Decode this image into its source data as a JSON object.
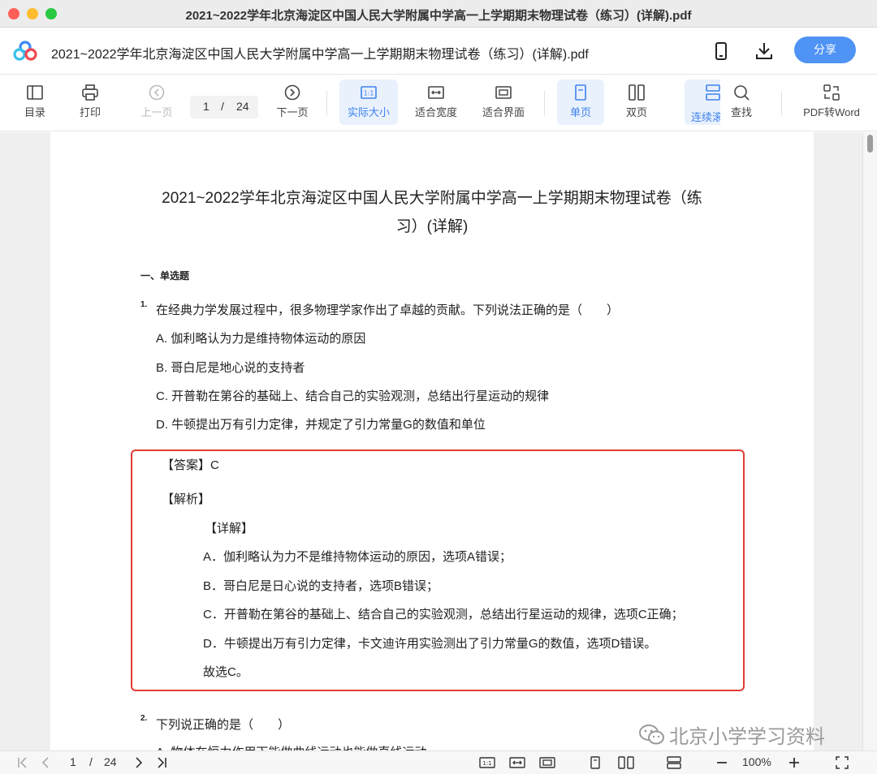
{
  "window": {
    "title": "2021~2022学年北京海淀区中国人民大学附属中学高一上学期期末物理试卷（练习）(详解).pdf"
  },
  "header": {
    "doc_title": "2021~2022学年北京海淀区中国人民大学附属中学高一上学期期末物理试卷（练习）(详解).pdf",
    "share_label": "分享",
    "icons": [
      "logo-icon",
      "phone-icon",
      "download-icon"
    ]
  },
  "toolbar": {
    "toc": "目录",
    "print": "打印",
    "prev": "上一页",
    "page_current": "1",
    "page_sep": "/",
    "page_total": "24",
    "next": "下一页",
    "actual_size": "实际大小",
    "fit_width": "适合宽度",
    "fit_page": "适合界面",
    "single": "单页",
    "double": "双页",
    "continuous": "连续滚",
    "find": "查找",
    "to_word": "PDF转Word"
  },
  "document": {
    "title_line1": "2021~2022学年北京海淀区中国人民大学附属中学高一上学期期末物理试卷（练",
    "title_line2": "习）(详解)",
    "section": "一、单选题",
    "q1": {
      "num": "1.",
      "stem": "在经典力学发展过程中，很多物理学家作出了卓越的贡献。下列说法正确的是（　　）",
      "options": [
        "A. 伽利略认为力是维持物体运动的原因",
        "B. 哥白尼是地心说的支持者",
        "C. 开普勒在第谷的基础上、结合自己的实验观测，总结出行星运动的规律",
        "D. 牛顿提出万有引力定律，并规定了引力常量G的数值和单位"
      ],
      "answer": "【答案】C",
      "analysis": "【解析】",
      "detail": "【详解】",
      "explanations": [
        "A．伽利略认为力不是维持物体运动的原因，选项A错误；",
        "B．哥白尼是日心说的支持者，选项B错误；",
        "C．开普勒在第谷的基础上、结合自己的实验观测，总结出行星运动的规律，选项C正确；",
        "D．牛顿提出万有引力定律，卡文迪许用实验测出了引力常量G的数值，选项D错误。",
        "故选C。"
      ]
    },
    "q2": {
      "num": "2.",
      "stem": "下列说正确的是（　　）",
      "partial": "A. 物体在恒力作用下能做曲线运动也能做直线运动"
    }
  },
  "watermark": "北京小学学习资料",
  "bottombar": {
    "page_current": "1",
    "page_sep": "/",
    "page_total": "24",
    "zoom": "100%"
  }
}
